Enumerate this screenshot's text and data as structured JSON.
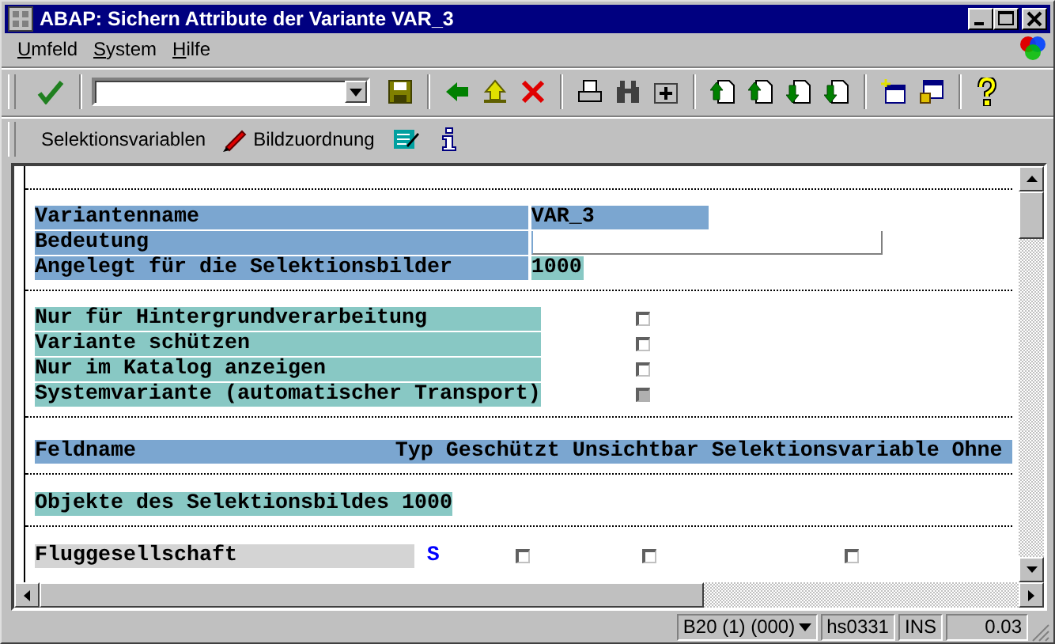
{
  "window": {
    "title": "ABAP: Sichern Attribute der Variante VAR_3"
  },
  "menu": [
    {
      "label": "Umfeld"
    },
    {
      "label": "System"
    },
    {
      "label": "Hilfe"
    }
  ],
  "app_toolbar": [
    {
      "label": "Selektionsvariablen"
    },
    {
      "label": "Bildzuordnung"
    }
  ],
  "attributes": [
    {
      "label": "Variantenname",
      "kind": "output",
      "value": "VAR_3"
    },
    {
      "label": "Bedeutung",
      "kind": "input"
    },
    {
      "label": "Angelegt für die Selektionsbilder",
      "kind": "number",
      "value": "1000"
    }
  ],
  "options": [
    {
      "label": "Nur für Hintergrundverarbeitung",
      "checked": false,
      "disabled": false
    },
    {
      "label": "Variante schützen",
      "checked": false,
      "disabled": false
    },
    {
      "label": "Nur im Katalog anzeigen",
      "checked": false,
      "disabled": false
    },
    {
      "label": "Systemvariante (automatischer Transport)",
      "checked": false,
      "disabled": true
    }
  ],
  "table": {
    "columns": [
      "Feldname",
      "Typ",
      "Geschützt",
      "Unsichtbar",
      "Selektionsvariable",
      "Ohne"
    ],
    "section": "Objekte des Selektionsbildes 1000",
    "rows": [
      {
        "field": "Fluggesellschaft",
        "type": "S",
        "protected": false,
        "invisible": false,
        "selection_variable": false
      }
    ]
  },
  "status_bar": {
    "system": "B20 (1) (000)",
    "server": "hs0331",
    "mode": "INS",
    "time": "0.03"
  }
}
